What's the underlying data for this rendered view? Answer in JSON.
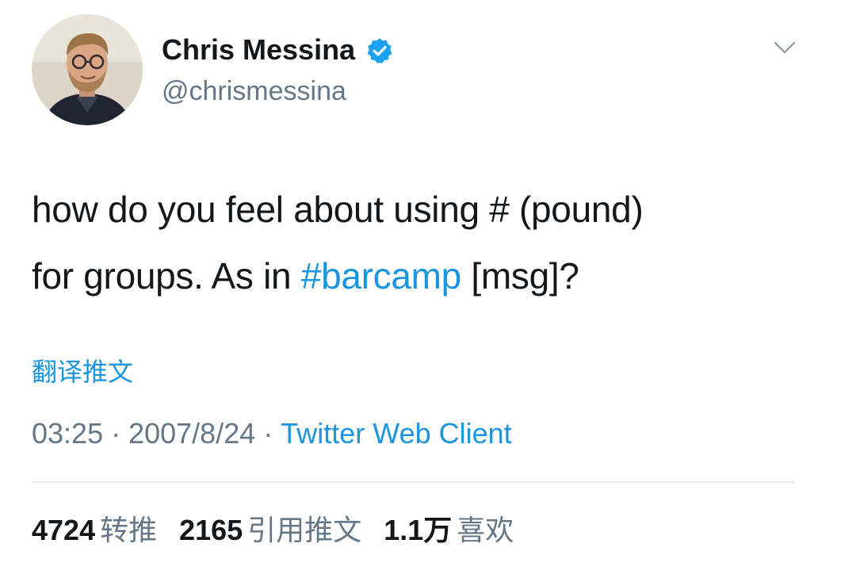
{
  "colors": {
    "text_primary": "#14171a",
    "text_secondary": "#657786",
    "link_blue": "#1b95e0",
    "verified_blue": "#1da1f2",
    "divider": "#e6ecf0"
  },
  "author": {
    "display_name": "Chris Messina",
    "handle": "@chrismessina",
    "verified": true,
    "avatar_icon": "profile-photo"
  },
  "tweet": {
    "line1": "how do you feel about using # (pound)",
    "line2_prefix": "for groups. As in ",
    "hashtag": "#barcamp",
    "line2_suffix": " [msg]?"
  },
  "translate_label": "翻译推文",
  "meta": {
    "time": "03:25",
    "separator": "·",
    "date": "2007/8/24",
    "client": "Twitter Web Client"
  },
  "stats": {
    "retweets": {
      "count": "4724",
      "label": "转推"
    },
    "quotes": {
      "count": "2165",
      "label": "引用推文"
    },
    "likes": {
      "count": "1.1万",
      "label": "喜欢"
    }
  }
}
